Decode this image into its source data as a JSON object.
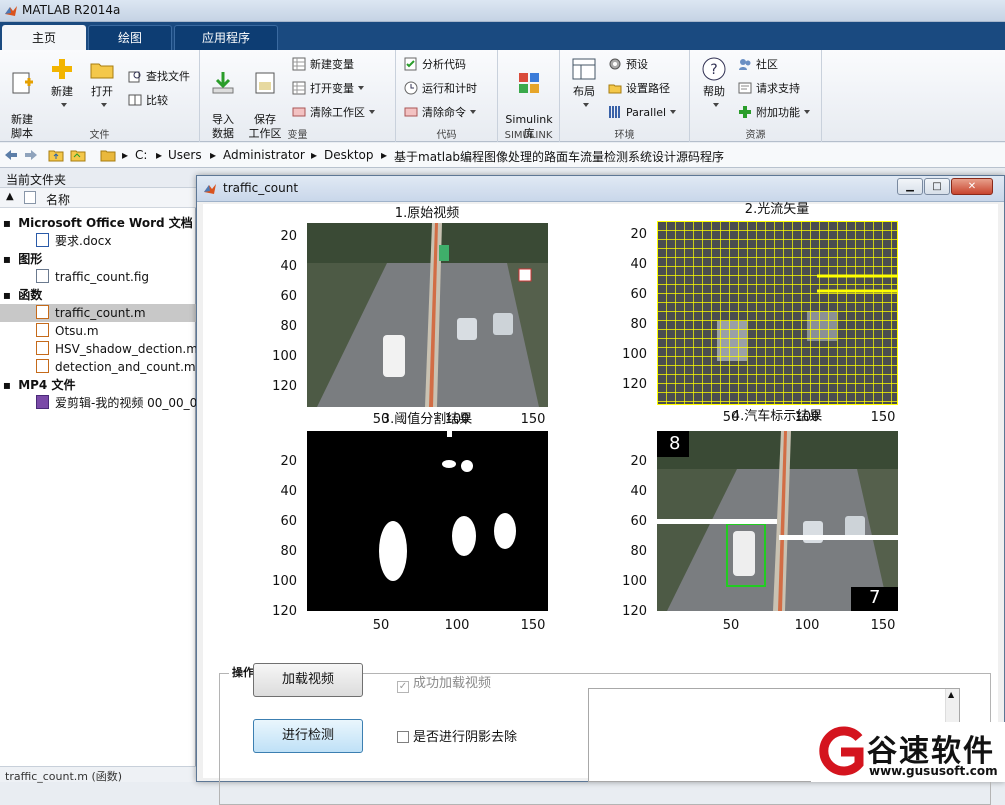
{
  "app": {
    "title": "MATLAB R2014a"
  },
  "tabs": [
    {
      "label": "主页"
    },
    {
      "label": "绘图"
    },
    {
      "label": "应用程序"
    }
  ],
  "ribbon": {
    "file": {
      "label": "文件",
      "new_script": "新建\n脚本",
      "new": "新建",
      "open": "打开",
      "find_files": "查找文件",
      "compare": "比较"
    },
    "variable": {
      "label": "变量",
      "import": "导入\n数据",
      "save_ws": "保存\n工作区",
      "new_var": "新建变量",
      "open_var": "打开变量",
      "clear_ws": "清除工作区"
    },
    "code": {
      "label": "代码",
      "analyze": "分析代码",
      "run_time": "运行和计时",
      "clear_cmd": "清除命令"
    },
    "simulink": {
      "label": "SIMULINK",
      "lib": "Simulink\n库"
    },
    "env": {
      "label": "环境",
      "layout": "布局",
      "prefs": "预设",
      "set_path": "设置路径",
      "parallel": "Parallel"
    },
    "resources": {
      "label": "资源",
      "help": "帮助",
      "community": "社区",
      "support": "请求支持",
      "addons": "附加功能"
    }
  },
  "address": {
    "crumbs": [
      "C:",
      "Users",
      "Administrator",
      "Desktop",
      "基于matlab编程图像处理的路面车流量检测系统设计源码程序"
    ]
  },
  "sidebar": {
    "title": "当前文件夹",
    "col_name": "名称",
    "col_sort": "▲",
    "groups": [
      {
        "label": "Microsoft Office Word 文档",
        "files": [
          "要求.docx"
        ]
      },
      {
        "label": "图形",
        "files": [
          "traffic_count.fig"
        ]
      },
      {
        "label": "函数",
        "files": [
          "traffic_count.m",
          "Otsu.m",
          "HSV_shadow_dection.m",
          "detection_and_count.m"
        ]
      },
      {
        "label": "MP4 文件",
        "files": [
          "爱剪辑-我的视频 00_00_0"
        ]
      }
    ],
    "status": "traffic_count.m (函数)"
  },
  "window": {
    "title": "traffic_count",
    "btn_min": "▁",
    "btn_max": "□",
    "btn_close": "✕",
    "plots": [
      {
        "title": "1.原始视频",
        "yticks": [
          "20",
          "40",
          "60",
          "80",
          "100",
          "120"
        ],
        "xticks": [
          "50",
          "100",
          "150"
        ]
      },
      {
        "title": "2.光流矢量",
        "yticks": [
          "20",
          "40",
          "60",
          "80",
          "100",
          "120"
        ],
        "xticks": [
          "50",
          "100",
          "150"
        ]
      },
      {
        "title": "3.阈值分割结果",
        "yticks": [
          "20",
          "40",
          "60",
          "80",
          "100",
          "120"
        ],
        "xticks": [
          "50",
          "100",
          "150"
        ]
      },
      {
        "title": "4.汽车标示结果",
        "yticks": [
          "20",
          "40",
          "60",
          "80",
          "100",
          "120"
        ],
        "xticks": [
          "50",
          "100",
          "150"
        ],
        "count_left": "8",
        "count_right": "7"
      }
    ],
    "panel": {
      "title": "操作",
      "load_btn": "加载视频",
      "detect_btn": "进行检测",
      "load_check": "成功加载视频",
      "load_check_mark": "✓",
      "shadow_check": "是否进行阴影去除",
      "scroll_up": "▲",
      "scroll_down": "▼"
    }
  },
  "watermark": {
    "name": "谷速软件",
    "url": "www.gususoft.com"
  },
  "colors": {
    "accent": "#1a4a80",
    "flow": "#ffff00",
    "box": "#22cc22"
  }
}
